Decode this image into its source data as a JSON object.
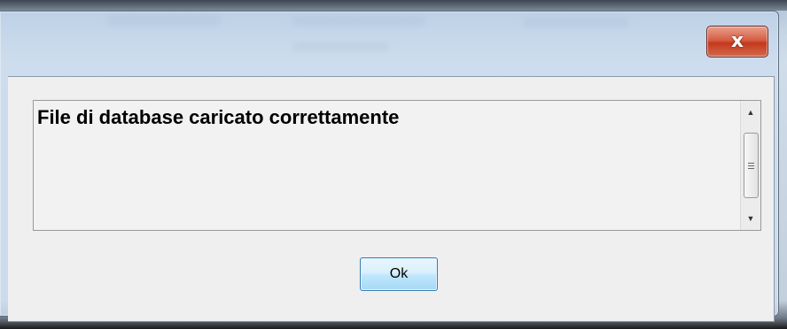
{
  "dialog": {
    "message": "File di database caricato correttamente",
    "ok_label": "Ok",
    "close_label": "x"
  },
  "colors": {
    "close_button": "#c4391e",
    "ok_button_border": "#3c7fb1",
    "client_background": "#efefef"
  },
  "icons": {
    "close": "close-icon",
    "scroll_up": "scroll-up-arrow-icon",
    "scroll_down": "scroll-down-arrow-icon",
    "scroll_grip": "scroll-grip-icon"
  }
}
